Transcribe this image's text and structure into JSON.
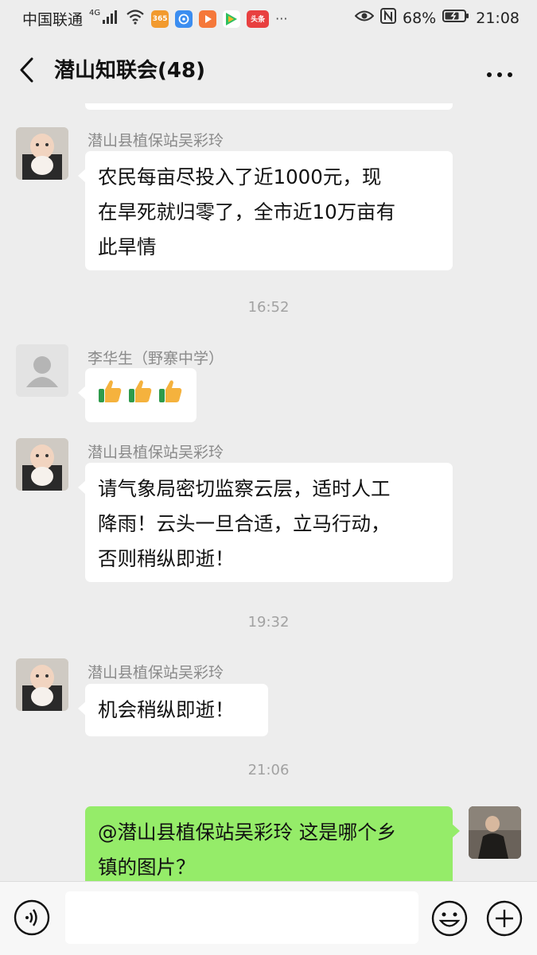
{
  "status_bar": {
    "carrier": "中国联通",
    "network": "4G",
    "app_badge_1": "365",
    "app_badge_2": "头条",
    "more_dots": "···",
    "battery": "68%",
    "time": "21:08"
  },
  "header": {
    "title": "潜山知联会(48)"
  },
  "messages": [
    {
      "sender": "潜山县植保站吴彩玲",
      "lines": [
        "农民每亩尽投入了近1000元，现",
        "在旱死就归零了，全市近10万亩有",
        "此旱情"
      ]
    },
    {
      "timestamp": "16:52"
    },
    {
      "sender": "李华生（野寨中学）",
      "emoji": "👍👍👍"
    },
    {
      "sender": "潜山县植保站吴彩玲",
      "lines": [
        "请气象局密切监察云层，适时人工",
        "降雨！云头一旦合适，立马行动，",
        "否则稍纵即逝！"
      ]
    },
    {
      "timestamp": "19:32"
    },
    {
      "sender": "潜山县植保站吴彩玲",
      "lines": [
        "机会稍纵即逝！"
      ]
    },
    {
      "timestamp": "21:06"
    },
    {
      "self": true,
      "lines": [
        "@潜山县植保站吴彩玲  这是哪个乡",
        "镇的图片？"
      ]
    }
  ],
  "input_bar": {
    "placeholder": ""
  },
  "colors": {
    "background": "#ededed",
    "bubble_incoming": "#ffffff",
    "bubble_outgoing": "#95ec69",
    "sender_name": "#8a8a8a",
    "timestamp": "#a2a2a2"
  }
}
